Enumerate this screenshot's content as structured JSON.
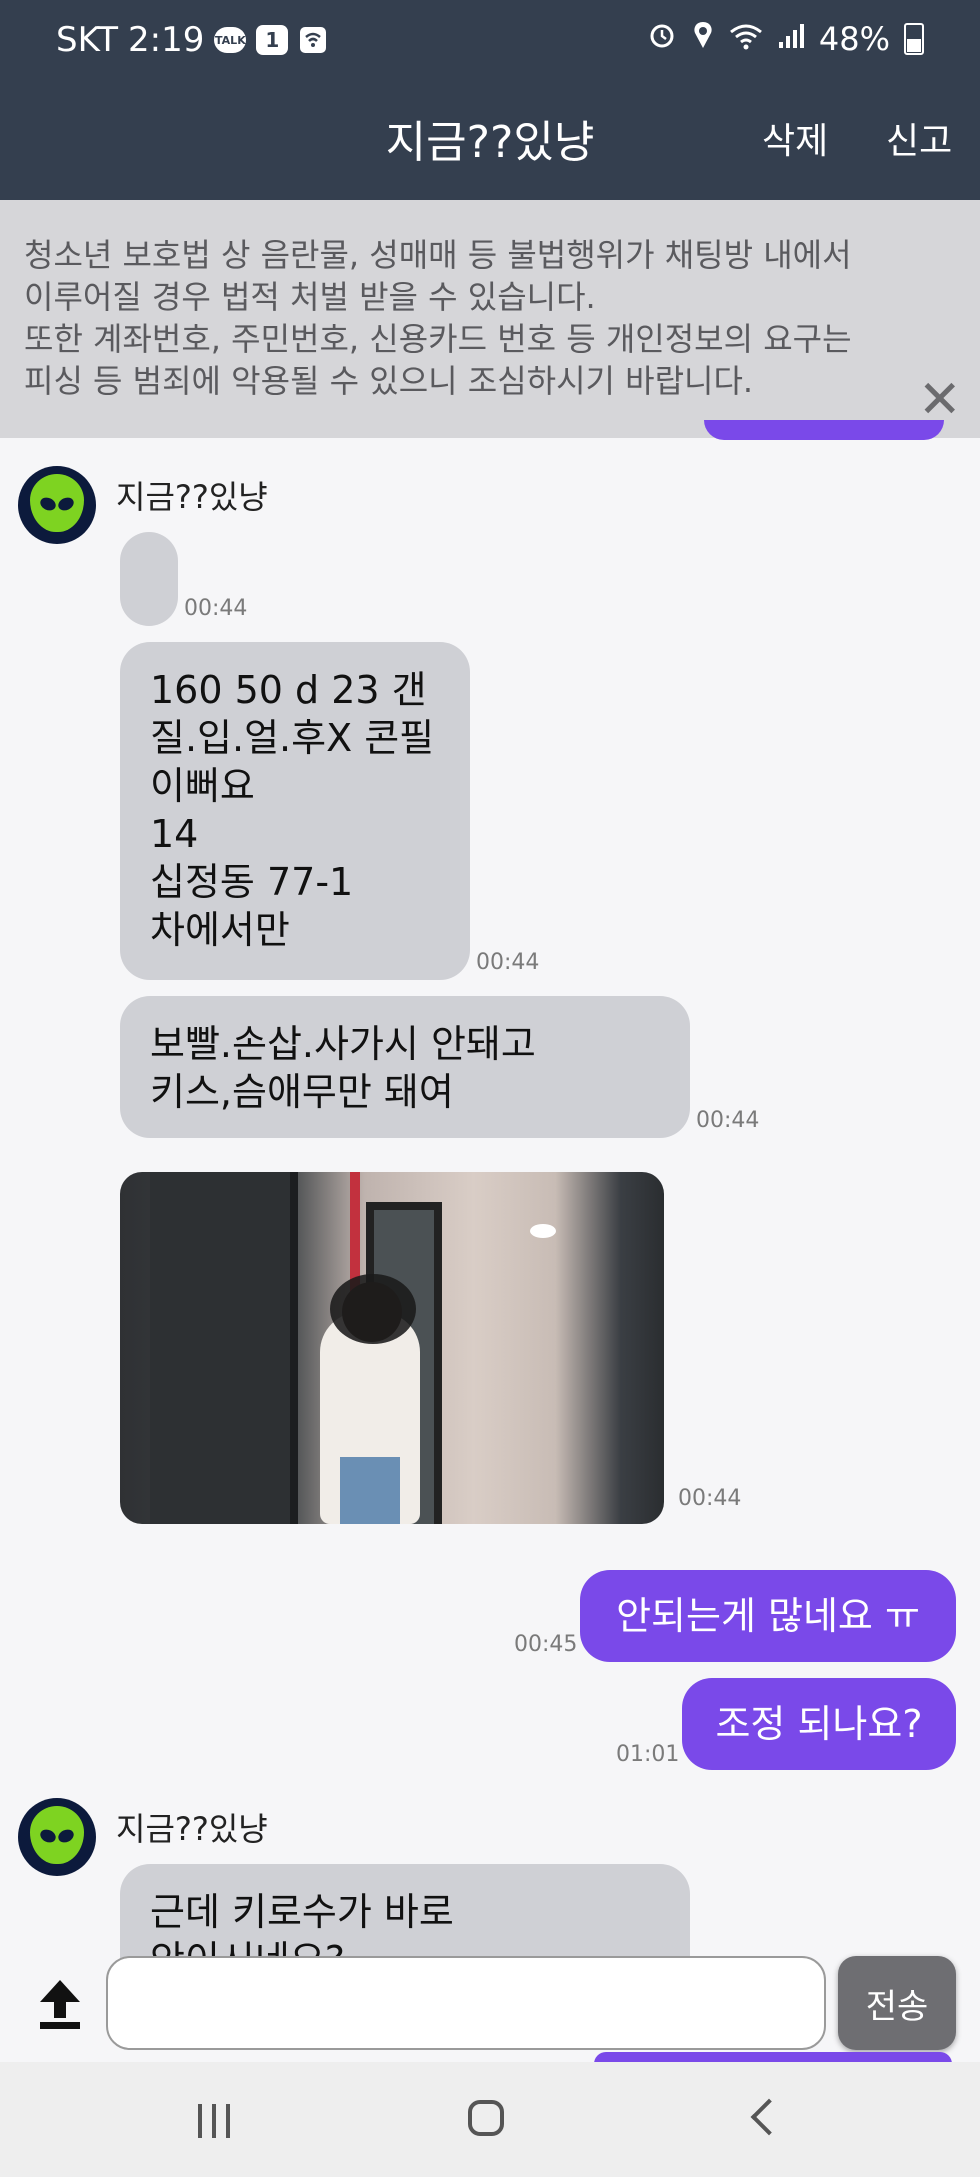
{
  "status_bar": {
    "carrier": "SKT",
    "time": "2:19",
    "talk_badge": "TALK",
    "badge_count": "1",
    "battery": "48%"
  },
  "header": {
    "title": "지금??있냥",
    "delete_label": "삭제",
    "report_label": "신고"
  },
  "notice": {
    "lines": [
      "청소년 보호법 상 음란물, 성매매 등 불법행위가 채팅방 내에서",
      "이루어질 경우 법적 처벌 받을 수 있습니다.",
      "또한 계좌번호, 주민번호, 신용카드 번호 등 개인정보의 요구는",
      "피싱 등 범죄에 악용될 수 있으니 조심하시기 바랍니다."
    ],
    "close_glyph": "✕"
  },
  "messages": [
    {
      "sender": "지금??있냥",
      "text": "",
      "time": "00:44"
    },
    {
      "text": "160 50 d 23 갠\n질.입.얼.후X 콘필\n이뻐요\n14\n십정동 77-1\n차에서만",
      "time": "00:44"
    },
    {
      "text": "보빨.손삽.사가시 안돼고\n키스,슴애무만 돼여",
      "time": "00:44"
    },
    {
      "type": "image",
      "time": "00:44"
    },
    {
      "mine": true,
      "text": "안되는게 많네요 ㅠ",
      "time": "00:45"
    },
    {
      "mine": true,
      "text": "조정 되나요?",
      "time": "01:01"
    },
    {
      "sender": "지금??있냥",
      "text": "근데 키로수가 바로\n안이시네요?"
    }
  ],
  "input": {
    "placeholder": "",
    "send_label": "전송"
  },
  "colors": {
    "header_bg": "#343f4f",
    "my_bubble": "#7a49e9",
    "their_bubble": "#cfd0d5",
    "notice_bg": "#d6d6d9"
  },
  "icons": {
    "upload": "upload-icon",
    "close": "close-icon",
    "avatar": "alien-avatar-icon"
  }
}
